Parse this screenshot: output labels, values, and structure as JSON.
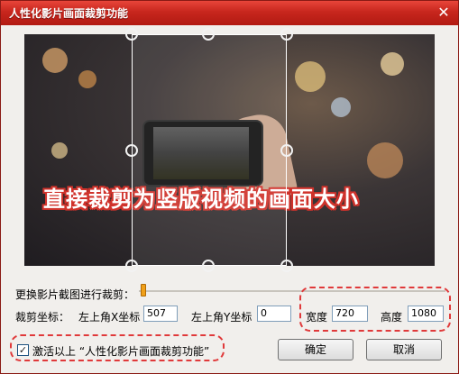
{
  "window": {
    "title": "人性化影片画面裁剪功能",
    "close_glyph": "✕"
  },
  "preview": {
    "overlay_text": "直接裁剪为竖版视频的画面大小"
  },
  "controls": {
    "crop_slider_label": "更换影片截图进行裁剪：",
    "crop_coords_label": "裁剪坐标：",
    "top_left_x_label": "左上角X坐标",
    "top_left_x_value": "507",
    "top_left_y_label": "左上角Y坐标",
    "top_left_y_value": "0",
    "width_label": "宽度",
    "width_value": "720",
    "height_label": "高度",
    "height_value": "1080"
  },
  "footer": {
    "activate_checkbox_label": "激活以上 “人性化影片画面裁剪功能”",
    "activate_checked": true,
    "ok_label": "确定",
    "cancel_label": "取消"
  },
  "colors": {
    "titlebar": "#c7261d",
    "highlight": "#e0393a",
    "slider_thumb": "#f0a019"
  }
}
